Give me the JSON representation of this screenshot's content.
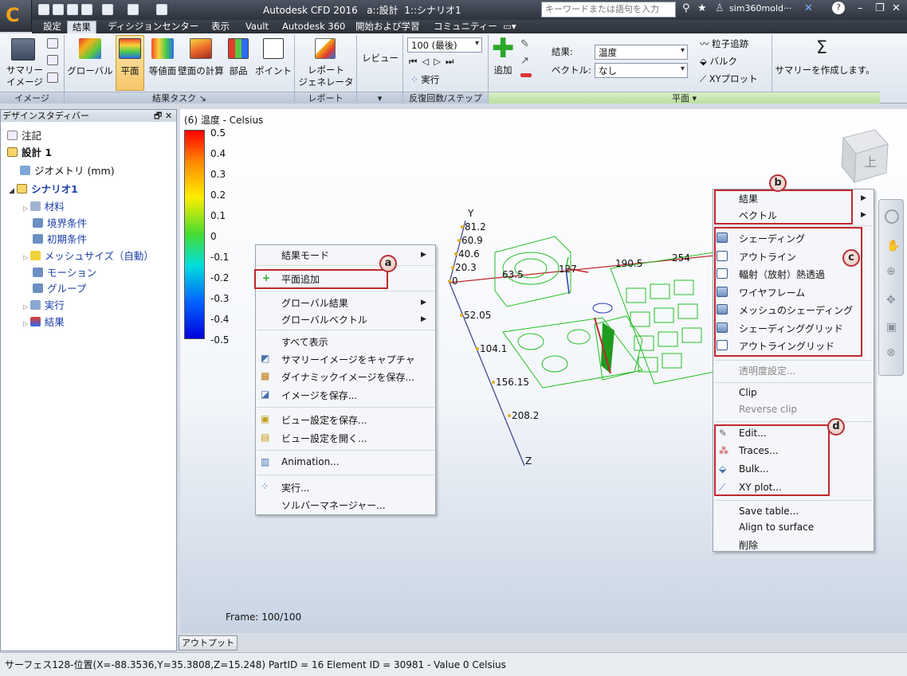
{
  "title_bar": {
    "app_title": "Autodesk CFD 2016   a::設計  1::シナリオ1",
    "search_placeholder": "キーワードまたは語句を入力",
    "user": "sim360mold···",
    "help_label": "?"
  },
  "tabs": [
    "設定",
    "結果",
    "ディシジョンセンター",
    "表示",
    "Vault",
    "Autodesk 360",
    "開始および学習",
    "コミュニティー"
  ],
  "ribbon": {
    "image_group": {
      "label1": "サマリー",
      "label2": "イメージ",
      "footer": "イメージ"
    },
    "result_task_group": {
      "buttons": [
        "グローバル",
        "平面",
        "等値面",
        "壁面の計算",
        "部品",
        "ポイント"
      ],
      "footer": "結果タスク"
    },
    "report_group": {
      "label1": "レポート",
      "label2": "ジェネレータ",
      "footer": "レポート"
    },
    "review": {
      "label": "レビュー"
    },
    "iteration_group": {
      "combo_value": "100 (最後)",
      "run_label": "実行",
      "footer": "反復回数/ステップ"
    },
    "plane_group": {
      "add_label": "追加",
      "result_label": "結果:",
      "result_value": "温度",
      "vector_label": "ベクトル:",
      "vector_value": "なし",
      "particle": "粒子追跡",
      "bulk": "バルク",
      "xyplot": "XYプロット",
      "summary": "サマリーを作成します。",
      "footer": "平面"
    }
  },
  "design_study_bar": {
    "header": "デザインスタディバー",
    "tree": [
      {
        "label": "注記"
      },
      {
        "label": "設計 1"
      },
      {
        "label": "ジオメトリ (mm)"
      },
      {
        "label": "シナリオ1"
      },
      {
        "label": "材料"
      },
      {
        "label": "境界条件"
      },
      {
        "label": "初期条件"
      },
      {
        "label": "メッシュサイズ（自動）"
      },
      {
        "label": "モーション"
      },
      {
        "label": "グループ"
      },
      {
        "label": "実行"
      },
      {
        "label": "結果"
      }
    ]
  },
  "viewport": {
    "legend_title": "(6) 温度 - Celsius",
    "legend_ticks": [
      "0.5",
      "0.4",
      "0.3",
      "0.2",
      "0.1",
      "0",
      "-0.1",
      "-0.2",
      "-0.3",
      "-0.4",
      "-0.5"
    ],
    "frame": "Frame: 100/100",
    "axis_y_label": "Y",
    "axis_z_label": "Z",
    "axis_y_ticks": [
      "81.2",
      "60.9",
      "40.6",
      "20.3",
      "0"
    ],
    "axis_z_ticks": [
      "52.05",
      "104.1",
      "156.15",
      "208.2"
    ],
    "axis_x_ticks": [
      "63.5",
      "127",
      "190.5",
      "254"
    ],
    "viewcube_label": "上"
  },
  "context_menu_a": {
    "items": [
      "結果モード",
      "平面追加",
      "グローバル結果",
      "グローバルベクトル",
      "すべて表示",
      "サマリーイメージをキャプチャ",
      "ダイナミックイメージを保存...",
      "イメージを保存...",
      "ビュー設定を保存...",
      "ビュー設定を開く...",
      "Animation...",
      "実行...",
      "ソルバーマネージャー..."
    ]
  },
  "context_menu_b": {
    "items": [
      "結果",
      "ベクトル",
      "シェーディング",
      "アウトライン",
      "輻射（放射）熱透過",
      "ワイヤフレーム",
      "メッシュのシェーディング",
      "シェーディンググリッド",
      "アウトライングリッド",
      "透明度設定...",
      "Clip",
      "Reverse clip",
      "Edit...",
      "Traces...",
      "Bulk...",
      "XY plot...",
      "Save table...",
      "Align to surface",
      "削除"
    ]
  },
  "callouts": [
    "a",
    "b",
    "c",
    "d"
  ],
  "output_bar": "アウトプットバー",
  "status": "サーフェス128-位置(X=-88.3536,Y=35.3808,Z=15.248) PartID = 16 Element ID = 30981 - Value 0  Celsius"
}
